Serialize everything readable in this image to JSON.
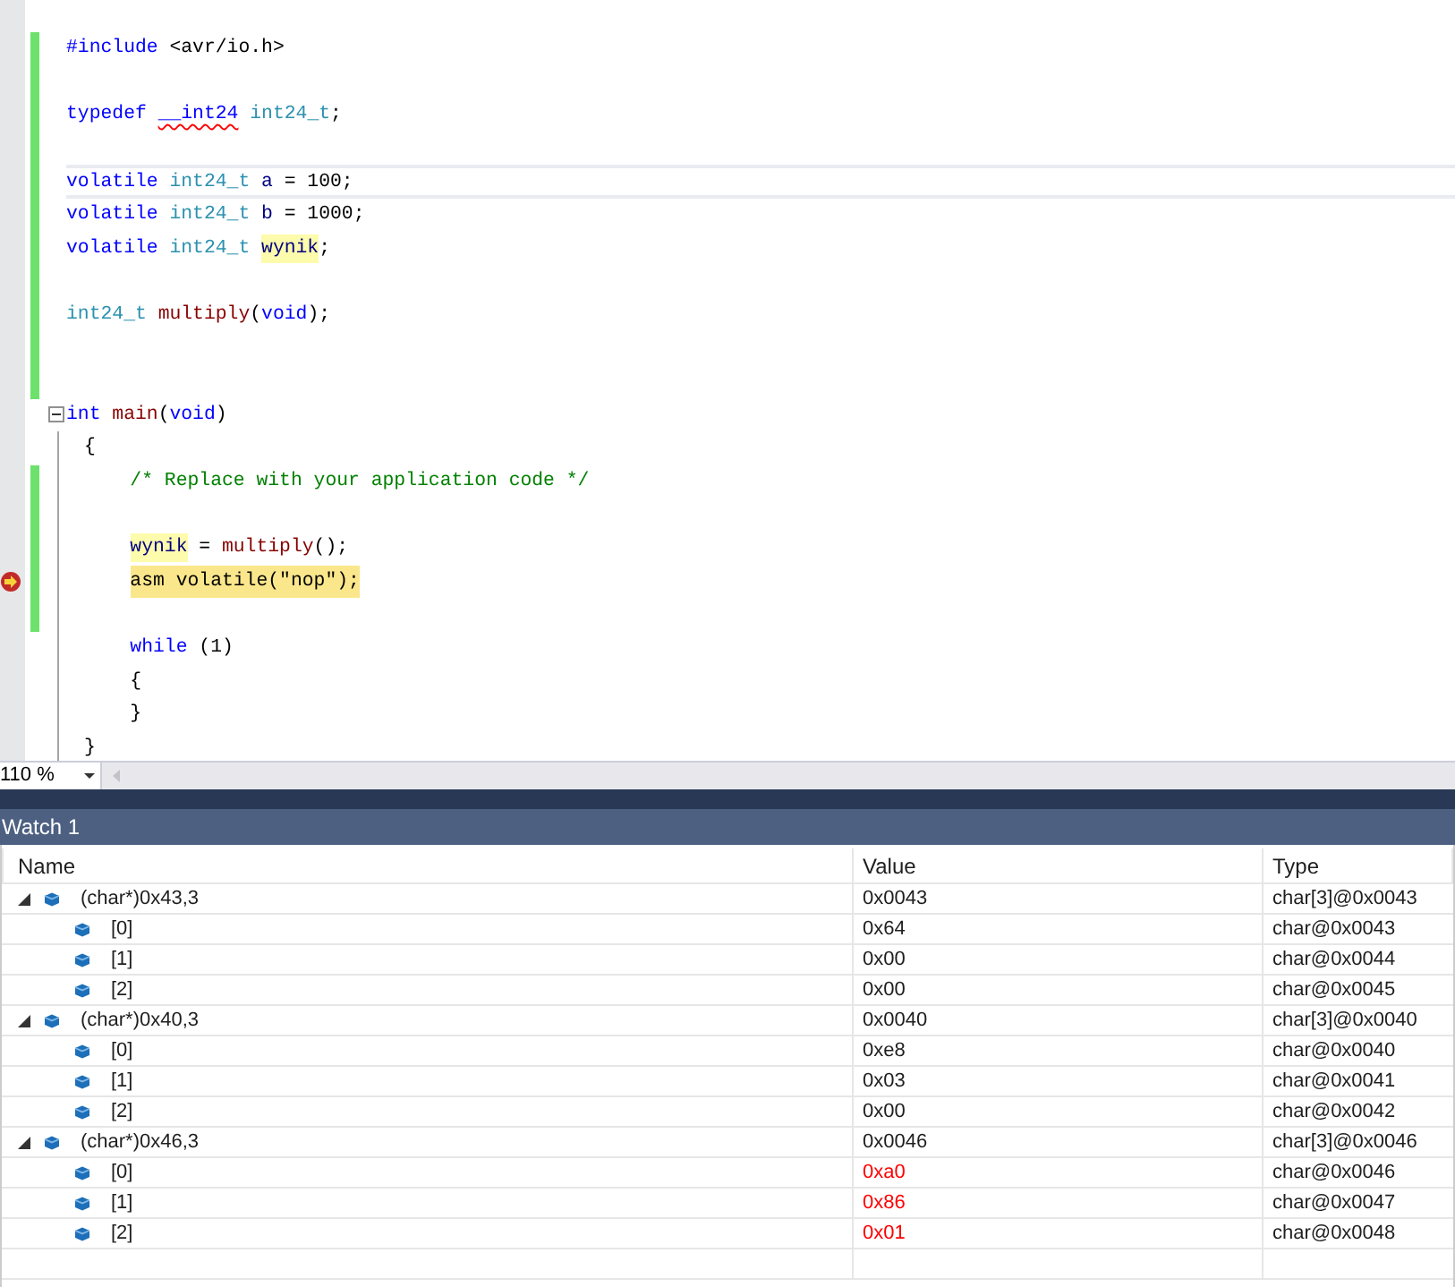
{
  "editor": {
    "lines": [
      {
        "changed": true,
        "tokens": [
          {
            "kind": "preproc",
            "text": "#include"
          },
          {
            "kind": "plain",
            "text": "<avr/io.h>",
            "space_before": true
          }
        ]
      },
      {
        "changed": true
      },
      {
        "changed": true,
        "tokens": [
          {
            "kind": "keyword",
            "text": "typedef"
          },
          {
            "kind": "keyword",
            "text": "__int24",
            "error": true,
            "space_before": true
          },
          {
            "kind": "type",
            "text": "int24_t",
            "space_before": true
          },
          {
            "kind": "plain",
            "text": ";"
          }
        ]
      },
      {
        "changed": true
      },
      {
        "changed": true,
        "caret": true,
        "tokens": [
          {
            "kind": "keyword",
            "text": "volatile"
          },
          {
            "kind": "type",
            "text": "int24_t",
            "space_before": true
          },
          {
            "kind": "variable",
            "text": "a",
            "space_before": true
          },
          {
            "kind": "plain",
            "text": "= 100;",
            "space_before": true
          }
        ]
      },
      {
        "changed": true,
        "tokens": [
          {
            "kind": "keyword",
            "text": "volatile"
          },
          {
            "kind": "type",
            "text": "int24_t",
            "space_before": true
          },
          {
            "kind": "variable",
            "text": "b",
            "space_before": true
          },
          {
            "kind": "plain",
            "text": "= 1000;",
            "space_before": true
          }
        ]
      },
      {
        "changed": true,
        "tokens": [
          {
            "kind": "keyword",
            "text": "volatile"
          },
          {
            "kind": "type",
            "text": "int24_t",
            "space_before": true
          },
          {
            "kind": "variable",
            "text": "wynik",
            "highlighted": true,
            "space_before": true
          },
          {
            "kind": "plain",
            "text": ";"
          }
        ]
      },
      {
        "changed": true
      },
      {
        "changed": true,
        "tokens": [
          {
            "kind": "type",
            "text": "int24_t"
          },
          {
            "kind": "function",
            "text": "multiply",
            "space_before": true
          },
          {
            "kind": "plain",
            "text": "("
          },
          {
            "kind": "keyword",
            "text": "void"
          },
          {
            "kind": "plain",
            "text": ");"
          }
        ]
      },
      {
        "changed": true
      },
      {
        "changed": true
      },
      {
        "changed": false,
        "expanded": true,
        "tokens": [
          {
            "kind": "keyword",
            "text": "int"
          },
          {
            "kind": "function",
            "text": "main",
            "space_before": true
          },
          {
            "kind": "plain",
            "text": "("
          },
          {
            "kind": "keyword",
            "text": "void"
          },
          {
            "kind": "plain",
            "text": ")"
          }
        ]
      },
      {
        "changed": false,
        "tokens": [
          {
            "kind": "plain",
            "text": "{"
          }
        ]
      },
      {
        "changed": true,
        "indented": true,
        "tokens": [
          {
            "kind": "comment",
            "text": "/* Replace with your application code */"
          }
        ]
      },
      {
        "changed": true
      },
      {
        "changed": true,
        "indented": true,
        "tokens": [
          {
            "kind": "variable",
            "text": "wynik",
            "highlighted": true
          },
          {
            "kind": "plain",
            "text": "=",
            "space_before": true
          },
          {
            "kind": "function",
            "text": "multiply",
            "space_before": true
          },
          {
            "kind": "plain",
            "text": "();"
          }
        ]
      },
      {
        "changed": true,
        "current": true,
        "indented": true,
        "tokens": [
          {
            "kind": "plain",
            "text": "asm volatile(\"nop\");"
          }
        ]
      },
      {
        "changed": true
      },
      {
        "changed": false,
        "indented": true,
        "tokens": [
          {
            "kind": "keyword",
            "text": "while"
          },
          {
            "kind": "plain",
            "text": "(1)",
            "space_before": true
          }
        ]
      },
      {
        "changed": false,
        "indented": true,
        "tokens": [
          {
            "kind": "plain",
            "text": "{"
          }
        ]
      },
      {
        "changed": false,
        "indented": true,
        "tokens": [
          {
            "kind": "plain",
            "text": "}"
          }
        ]
      },
      {
        "changed": false,
        "tokens": [
          {
            "kind": "plain",
            "text": "}"
          }
        ]
      }
    ],
    "zoom": "110 %"
  },
  "watch": {
    "title": "Watch 1",
    "columns": [
      "Name",
      "Value",
      "Type"
    ],
    "rows": [
      {
        "name": "(char*)0x43,3",
        "value": "0x0043",
        "type": "char[3]@0x0043",
        "changed": false,
        "expanded": true,
        "children": [
          {
            "name": "[0]",
            "value": "0x64",
            "type": "char@0x0043",
            "changed": false
          },
          {
            "name": "[1]",
            "value": "0x00",
            "type": "char@0x0044",
            "changed": false
          },
          {
            "name": "[2]",
            "value": "0x00",
            "type": "char@0x0045",
            "changed": false
          }
        ]
      },
      {
        "name": "(char*)0x40,3",
        "value": "0x0040",
        "type": "char[3]@0x0040",
        "changed": false,
        "expanded": true,
        "children": [
          {
            "name": "[0]",
            "value": "0xe8",
            "type": "char@0x0040",
            "changed": false
          },
          {
            "name": "[1]",
            "value": "0x03",
            "type": "char@0x0041",
            "changed": false
          },
          {
            "name": "[2]",
            "value": "0x00",
            "type": "char@0x0042",
            "changed": false
          }
        ]
      },
      {
        "name": "(char*)0x46,3",
        "value": "0x0046",
        "type": "char[3]@0x0046",
        "changed": false,
        "expanded": true,
        "children": [
          {
            "name": "[0]",
            "value": "0xa0",
            "type": "char@0x0046",
            "changed": true
          },
          {
            "name": "[1]",
            "value": "0x86",
            "type": "char@0x0047",
            "changed": true
          },
          {
            "name": "[2]",
            "value": "0x01",
            "type": "char@0x0048",
            "changed": true
          }
        ]
      }
    ]
  }
}
